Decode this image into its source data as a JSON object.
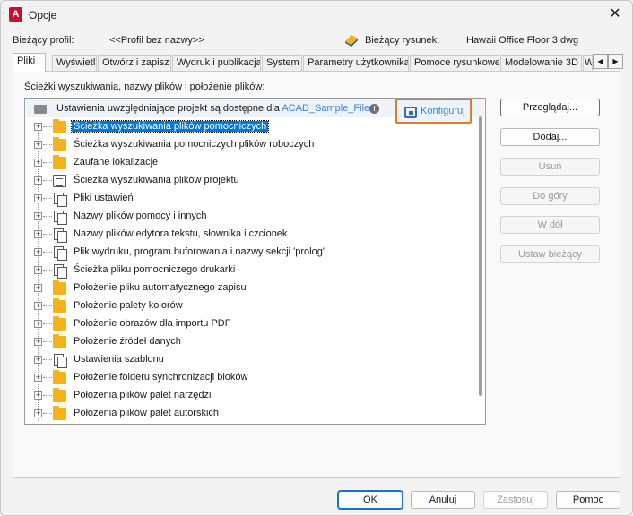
{
  "window": {
    "app_logo_letter": "A",
    "title": "Opcje",
    "close_glyph": "✕"
  },
  "profile": {
    "label": "Bieżący profil:",
    "value": "<<Profil bez nazwy>>",
    "drawing_label": "Bieżący rysunek:",
    "drawing_value": "Hawaii Office Floor 3.dwg"
  },
  "tabs": [
    {
      "label": "Pliki",
      "active": true
    },
    {
      "label": "Wyświetl"
    },
    {
      "label": "Otwórz i zapisz"
    },
    {
      "label": "Wydruk i publikacja"
    },
    {
      "label": "System"
    },
    {
      "label": "Parametry użytkownika"
    },
    {
      "label": "Pomoce rysunkowe"
    },
    {
      "label": "Modelowanie 3D"
    },
    {
      "label": "W"
    }
  ],
  "tab_arrows": {
    "left": "◀",
    "right": "▶"
  },
  "section_label": "Ścieżki wyszukiwania, nazwy plików i położenie plików:",
  "tree_header": {
    "text": "Ustawienia uwzględniające projekt są dostępne dla ",
    "link": "ACAD_Sample_Files",
    "info_glyph": "i",
    "configure_label": "Konfiguruj"
  },
  "tree_items": [
    {
      "label": "Ścieżka wyszukiwania plików pomocniczych",
      "icon": "folder-icon",
      "selected": true
    },
    {
      "label": "Ścieżka wyszukiwania pomocniczych plików roboczych",
      "icon": "folder-icon"
    },
    {
      "label": "Zaufane lokalizacje",
      "icon": "folder-icon"
    },
    {
      "label": "Ścieżka wyszukiwania plików projektu",
      "icon": "project-icon"
    },
    {
      "label": "Pliki ustawień",
      "icon": "documents-icon"
    },
    {
      "label": "Nazwy plików pomocy i innych",
      "icon": "documents-icon"
    },
    {
      "label": "Nazwy plików edytora tekstu, słownika i czcionek",
      "icon": "documents-icon"
    },
    {
      "label": "Plik wydruku, program buforowania i nazwy sekcji 'prolog'",
      "icon": "documents-icon"
    },
    {
      "label": "Ścieżka pliku pomocniczego drukarki",
      "icon": "documents-icon"
    },
    {
      "label": "Położenie pliku automatycznego zapisu",
      "icon": "folder-icon"
    },
    {
      "label": "Położenie palety kolorów",
      "icon": "folder-icon"
    },
    {
      "label": "Położenie obrazów dla importu PDF",
      "icon": "folder-icon"
    },
    {
      "label": "Położenie źródeł danych",
      "icon": "folder-icon"
    },
    {
      "label": "Ustawienia szablonu",
      "icon": "documents-icon"
    },
    {
      "label": "Położenie folderu synchronizacji bloków",
      "icon": "folder-icon"
    },
    {
      "label": "Położenia plików palet narzędzi",
      "icon": "folder-icon"
    },
    {
      "label": "Położenia plików palet autorskich",
      "icon": "folder-icon"
    }
  ],
  "expander_glyph": "+",
  "side_buttons": {
    "browse": "Przeglądaj...",
    "add": "Dodaj...",
    "remove": "Usuń",
    "move_up": "Do góry",
    "move_down": "W dół",
    "set_current": "Ustaw bieżący"
  },
  "bottom_buttons": {
    "ok": "OK",
    "cancel": "Anuluj",
    "apply": "Zastosuj",
    "help": "Pomoc"
  },
  "colors": {
    "accent_link": "#3b86c6",
    "selection": "#0078d7",
    "highlight_border": "#e27b29",
    "folder": "#f5b317"
  }
}
